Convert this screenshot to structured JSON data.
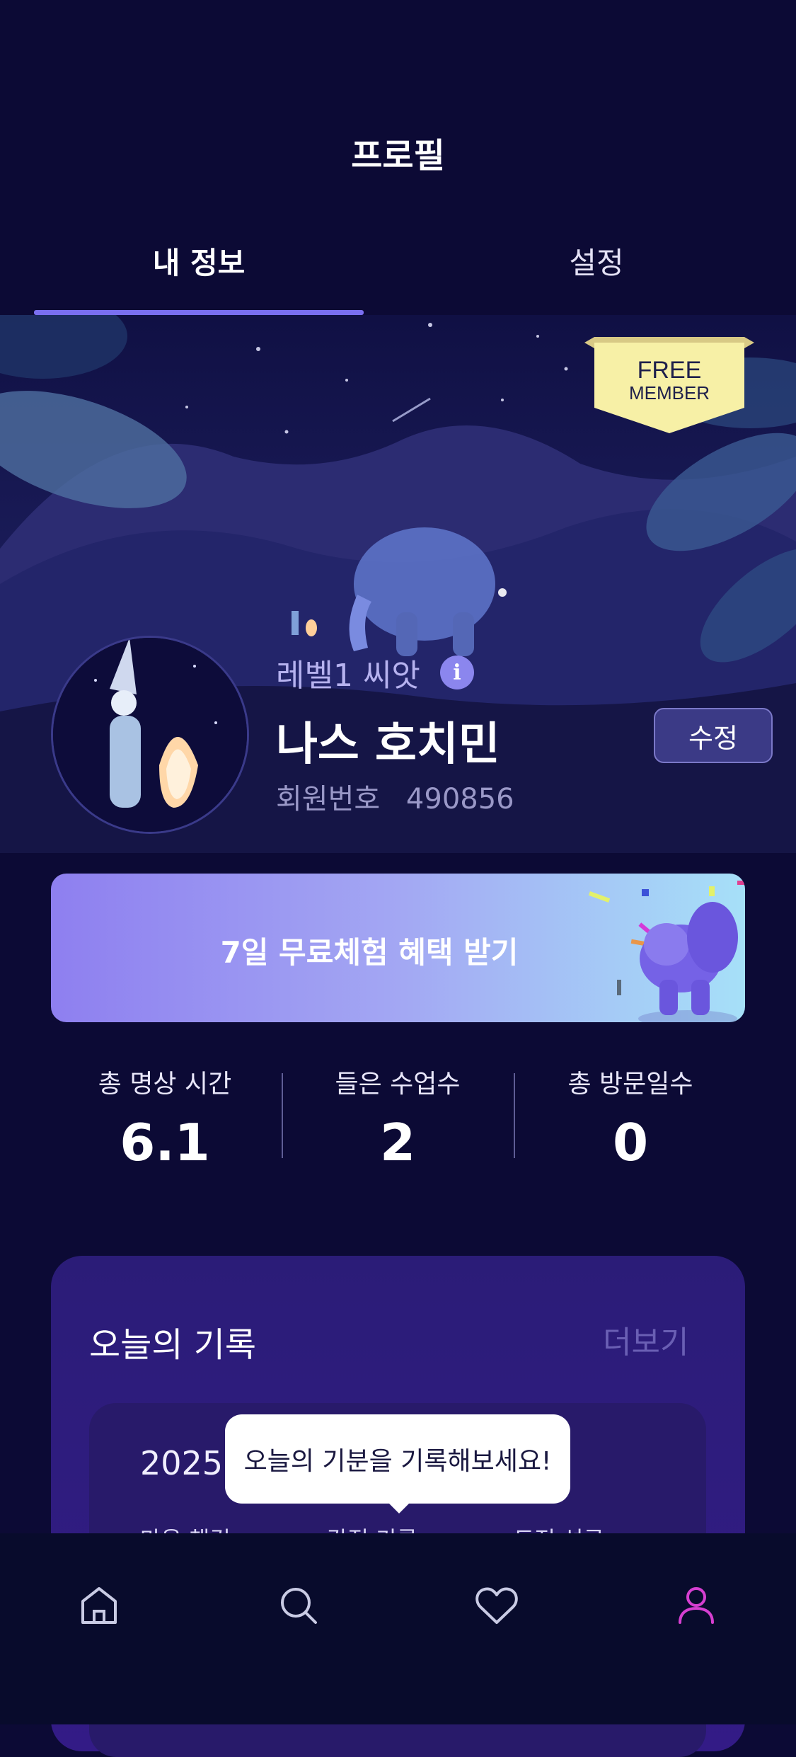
{
  "header": {
    "title": "프로필"
  },
  "tabs": [
    {
      "label": "내 정보",
      "active": true
    },
    {
      "label": "설정",
      "active": false
    }
  ],
  "badge": {
    "line1": "FREE",
    "line2": "MEMBER"
  },
  "profile": {
    "level": "레벨1 씨앗",
    "name": "나스 호치민",
    "member_label": "회원번호",
    "member_number": "490856",
    "edit_label": "수정"
  },
  "trial_banner": {
    "text": "7일 무료체험 혜택 받기"
  },
  "stats": [
    {
      "label": "총 명상 시간",
      "value": "6.1"
    },
    {
      "label": "들은 수업수",
      "value": "2"
    },
    {
      "label": "총 방문일수",
      "value": "0"
    }
  ],
  "record": {
    "title": "오늘의 기록",
    "more": "더보기",
    "date": "2025.",
    "columns": [
      "마음 챙김",
      "감정 기록",
      "도전 성공"
    ],
    "tooltip": "오늘의 기분을 기록해보세요!"
  },
  "bottom_nav": [
    {
      "icon": "home-icon"
    },
    {
      "icon": "search-icon"
    },
    {
      "icon": "heart-icon"
    },
    {
      "icon": "profile-icon",
      "active_color": "#d63fd1"
    }
  ],
  "colors": {
    "background": "#0c0a35",
    "accent": "#7a6ff0",
    "nav_active": "#d63fd1"
  }
}
